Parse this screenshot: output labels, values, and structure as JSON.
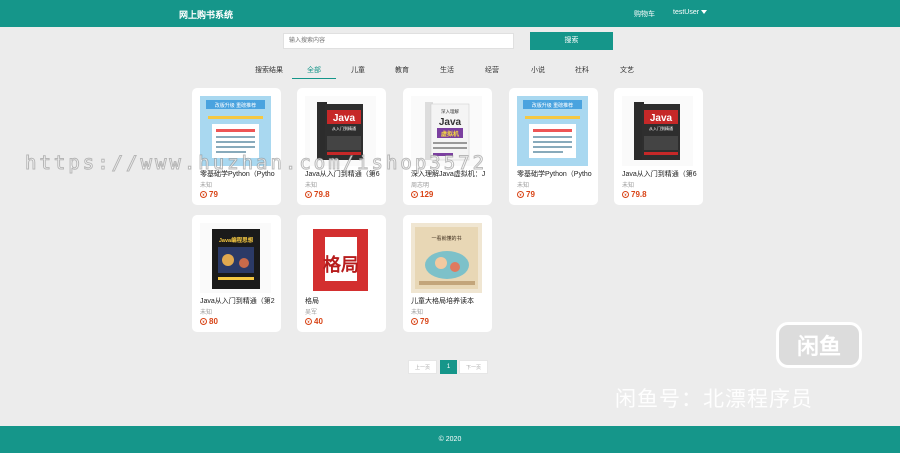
{
  "header": {
    "title": "网上购书系统",
    "cart_label": "购物车",
    "user_label": "testUser"
  },
  "search": {
    "placeholder": "输入搜索内容",
    "button_label": "搜索"
  },
  "categories": [
    "搜索结果",
    "全部",
    "儿童",
    "教育",
    "生活",
    "经营",
    "小说",
    "社科",
    "文艺"
  ],
  "active_category": "全部",
  "books": [
    {
      "title": "零基础学Python（Pytho",
      "author": "未知",
      "price": "79"
    },
    {
      "title": "Java从入门到精通（第6",
      "author": "未知",
      "price": "79.8"
    },
    {
      "title": "深入理解Java虚拟机：J",
      "author": "周志明",
      "price": "129"
    },
    {
      "title": "零基础学Python（Pytho",
      "author": "未知",
      "price": "79"
    },
    {
      "title": "Java从入门到精通（第6",
      "author": "未知",
      "price": "79.8"
    },
    {
      "title": "Java从入门到精通（第2",
      "author": "未知",
      "price": "80"
    },
    {
      "title": "格局",
      "author": "吴军",
      "price": "40"
    },
    {
      "title": "儿童大格局培养读本",
      "author": "未知",
      "price": "79"
    }
  ],
  "cover_text": {
    "python_top": "改版升级 重磅推荐",
    "java_big": "Java",
    "java_sub": "从入门到精通",
    "jvm_big": "深入理解",
    "jvm_java": "Java",
    "jvm_sub": "虚拟机",
    "java2_top": "Java编程思想",
    "gj_big": "格局",
    "child_top": "一看就懂的书"
  },
  "pagination": {
    "prev": "上一页",
    "current": "1",
    "next": "下一页"
  },
  "footer": {
    "copyright": "© 2020"
  },
  "watermark": {
    "url": "https://www.huzhan.com/ishop3572",
    "seller": "闲鱼号：北漂程序员",
    "logo": "闲鱼"
  },
  "colors": {
    "primary": "#15968a",
    "price": "#d84315",
    "background": "#ececec"
  }
}
